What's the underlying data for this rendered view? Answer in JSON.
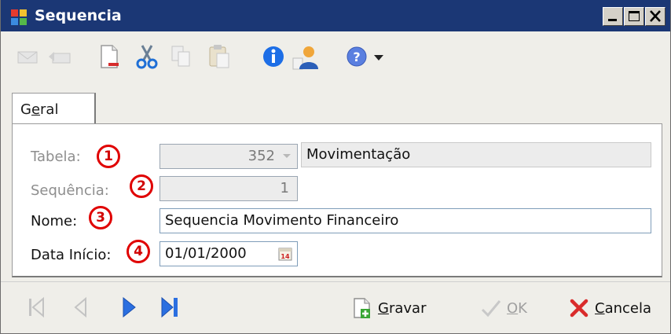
{
  "window": {
    "title": "Sequencia"
  },
  "colors": {
    "titlebar": "#1b3775",
    "badge_red": "#e00000",
    "panel": "#efeee9"
  },
  "toolbar": {
    "icons": [
      "mail-icon",
      "mail-reply-icon",
      "new-document-icon",
      "cut-icon",
      "copy-icon",
      "paste-icon",
      "info-icon",
      "user-icon",
      "help-icon",
      "dropdown-arrow-icon"
    ]
  },
  "tabs": [
    {
      "pre": "G",
      "accel": "e",
      "post": "ral"
    }
  ],
  "form": {
    "tabela": {
      "label": "Tabela:",
      "badge": "1",
      "code": "352",
      "description": "Movimentação"
    },
    "sequencia": {
      "label": "Sequência:",
      "badge": "2",
      "value": "1"
    },
    "nome": {
      "label": "Nome:",
      "badge": "3",
      "value": "Sequencia Movimento Financeiro"
    },
    "data_inicio": {
      "label": "Data Início:",
      "badge": "4",
      "value": "01/01/2000"
    }
  },
  "actions": {
    "gravar": {
      "accel": "G",
      "rest": "ravar"
    },
    "ok": {
      "accel": "O",
      "rest": "K"
    },
    "cancela": {
      "accel": "C",
      "rest": "ancela"
    }
  }
}
